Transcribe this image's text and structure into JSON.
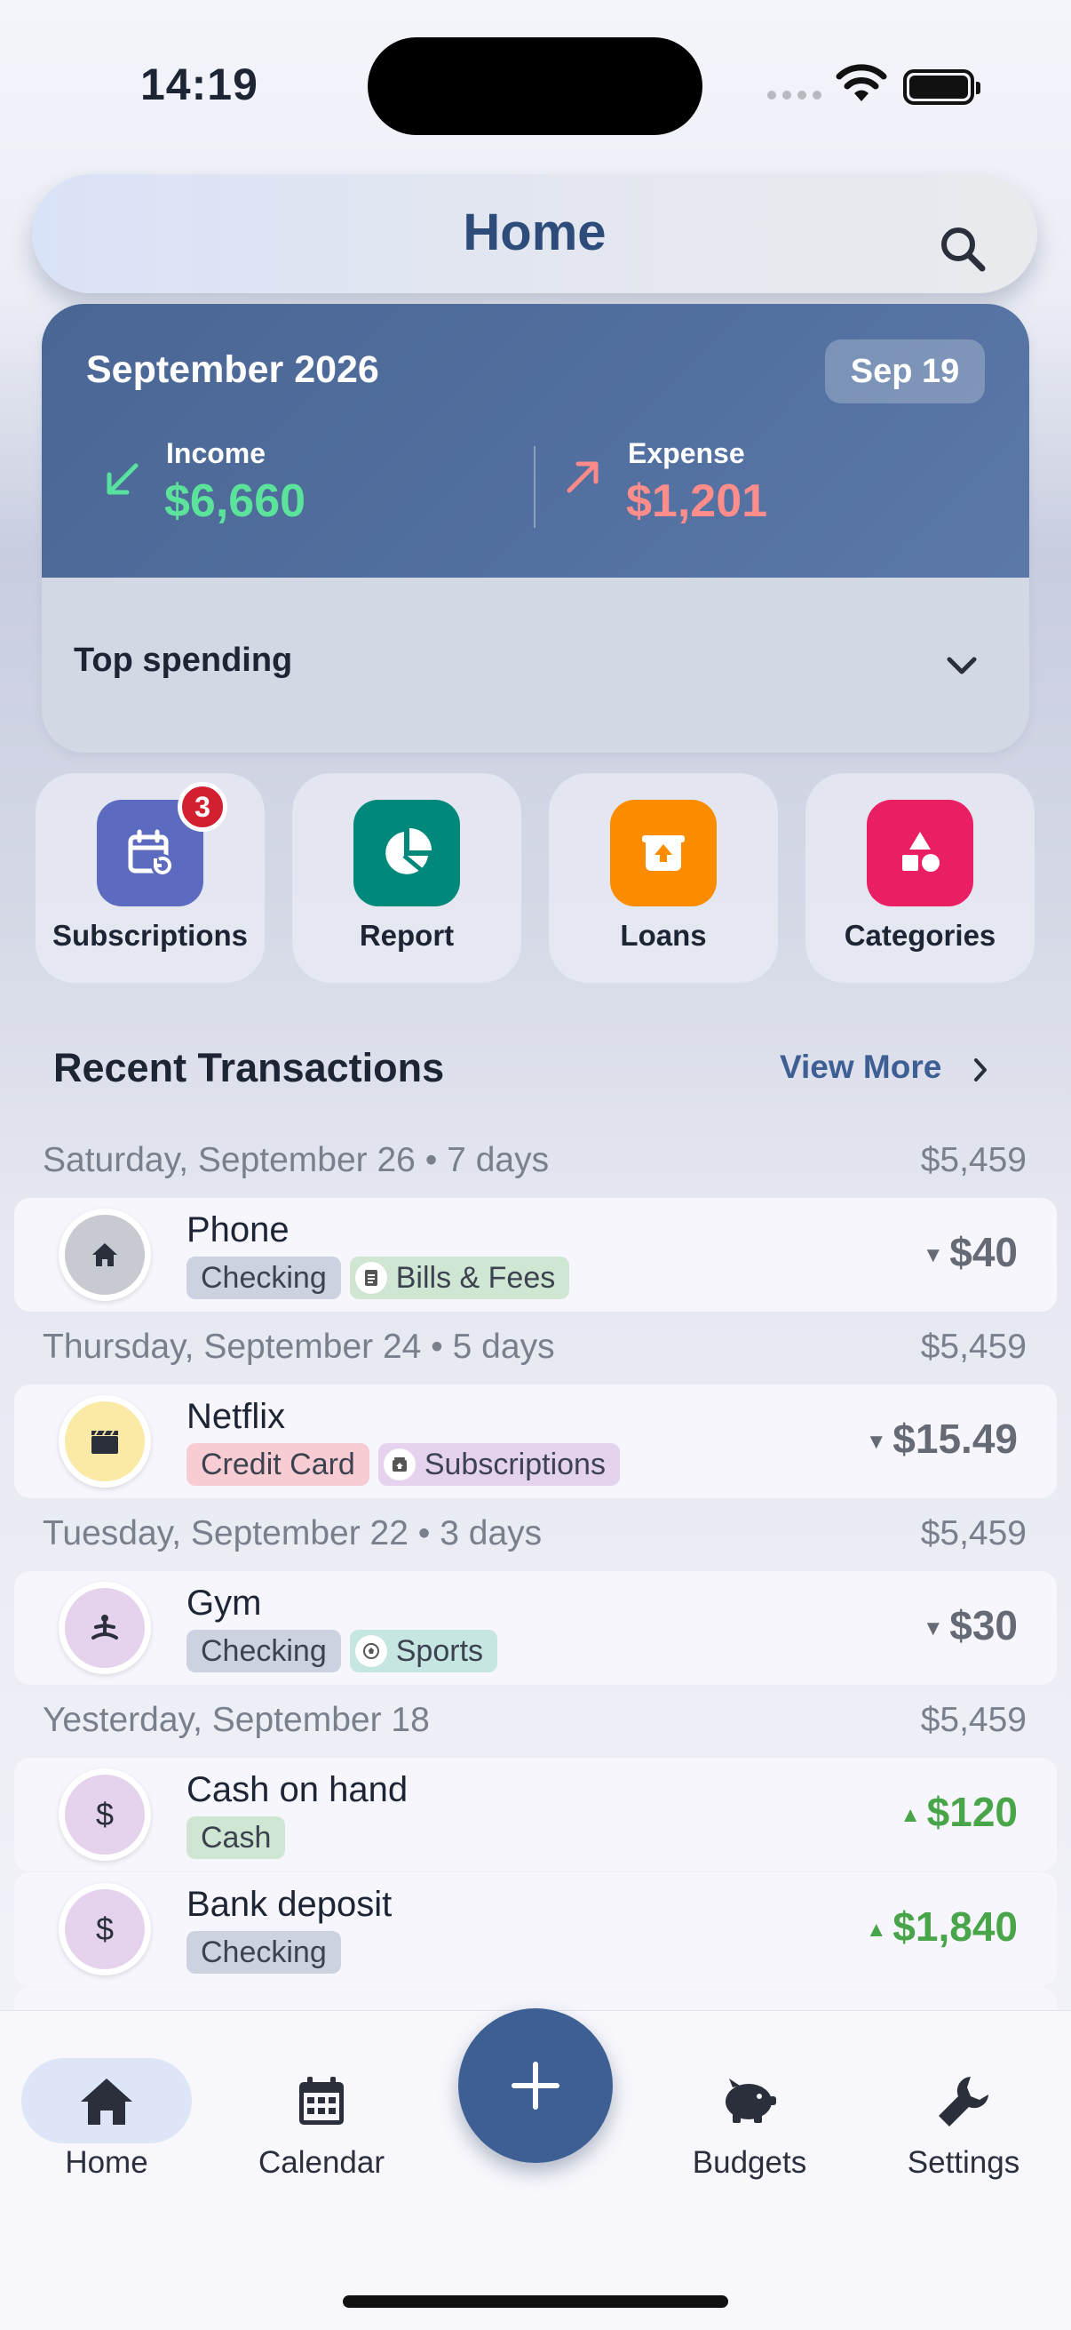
{
  "status_bar": {
    "time": "14:19"
  },
  "header": {
    "title": "Home"
  },
  "summary": {
    "month": "September 2026",
    "date_badge": "Sep 19",
    "income_label": "Income",
    "income_value": "$6,660",
    "expense_label": "Expense",
    "expense_value": "$1,201",
    "top_spending_label": "Top spending",
    "colors": {
      "income": "#5be39c",
      "expense": "#ff8d8b",
      "card": "#4f6c9c"
    }
  },
  "quick_actions": [
    {
      "label": "Subscriptions",
      "icon": "calendar-refresh-icon",
      "color": "#5c6bc0",
      "badge": "3"
    },
    {
      "label": "Report",
      "icon": "pie-chart-icon",
      "color": "#00897b"
    },
    {
      "label": "Loans",
      "icon": "archive-upload-icon",
      "color": "#fb8c00"
    },
    {
      "label": "Categories",
      "icon": "shapes-icon",
      "color": "#e91e63"
    }
  ],
  "recent": {
    "title": "Recent Transactions",
    "view_more": "View More",
    "groups": [
      {
        "day": "Saturday, September 26 • 7 days",
        "balance": "$5,459",
        "items": [
          {
            "name": "Phone",
            "account": "Checking",
            "category": "Bills & Fees",
            "amount": "$40",
            "direction": "expense",
            "icon": "home-icon"
          }
        ]
      },
      {
        "day": "Thursday, September 24 • 5 days",
        "balance": "$5,459",
        "items": [
          {
            "name": "Netflix",
            "account": "Credit Card",
            "category": "Subscriptions",
            "amount": "$15.49",
            "direction": "expense",
            "icon": "clapperboard-icon"
          }
        ]
      },
      {
        "day": "Tuesday, September 22 • 3 days",
        "balance": "$5,459",
        "items": [
          {
            "name": "Gym",
            "account": "Checking",
            "category": "Sports",
            "amount": "$30",
            "direction": "expense",
            "icon": "yoga-icon"
          }
        ]
      },
      {
        "day": "Yesterday, September 18",
        "balance": "$5,459",
        "items": [
          {
            "name": "Cash on hand",
            "account": "Cash",
            "amount": "$120",
            "direction": "income",
            "icon": "dollar-icon"
          },
          {
            "name": "Bank deposit",
            "account": "Checking",
            "amount": "$1,840",
            "direction": "income",
            "icon": "dollar-icon"
          }
        ]
      }
    ]
  },
  "nav": {
    "items": [
      {
        "label": "Home",
        "icon": "home-icon",
        "active": true
      },
      {
        "label": "Calendar",
        "icon": "calendar-icon"
      },
      {
        "label": "Budgets",
        "icon": "piggy-bank-icon"
      },
      {
        "label": "Settings",
        "icon": "wrench-icon"
      }
    ],
    "fab_icon": "plus-icon"
  }
}
